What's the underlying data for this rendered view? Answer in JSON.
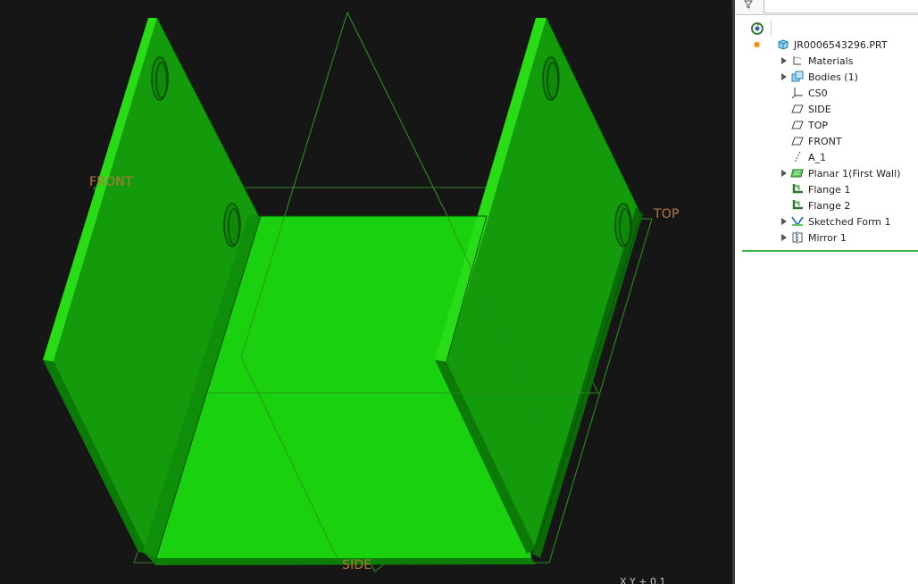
{
  "viewport": {
    "plane_labels": {
      "front": "FRONT",
      "top": "TOP",
      "side": "SIDE"
    },
    "coordinate_readout": "X Y + 0.1",
    "colors": {
      "background": "#161616",
      "part": "#22cc11",
      "datum": "#b8773f",
      "datum_lines": "#2e8a22"
    }
  },
  "model_tree": {
    "root": {
      "label": "JR0006543296.PRT",
      "icon": "part-icon"
    },
    "items": [
      {
        "label": "Materials",
        "icon": "materials-icon",
        "expandable": true
      },
      {
        "label": "Bodies (1)",
        "icon": "bodies-icon",
        "expandable": true
      },
      {
        "label": "CS0",
        "icon": "coordinate-system-icon",
        "expandable": false
      },
      {
        "label": "SIDE",
        "icon": "datum-plane-icon",
        "expandable": false
      },
      {
        "label": "TOP",
        "icon": "datum-plane-icon",
        "expandable": false
      },
      {
        "label": "FRONT",
        "icon": "datum-plane-icon",
        "expandable": false
      },
      {
        "label": "A_1",
        "icon": "datum-axis-icon",
        "expandable": false
      },
      {
        "label": "Planar 1(First Wall)",
        "icon": "planar-wall-icon",
        "expandable": true
      },
      {
        "label": "Flange 1",
        "icon": "flange-icon",
        "expandable": false
      },
      {
        "label": "Flange 2",
        "icon": "flange-icon",
        "expandable": false
      },
      {
        "label": "Sketched Form 1",
        "icon": "sketched-form-icon",
        "expandable": true
      },
      {
        "label": "Mirror 1",
        "icon": "mirror-icon",
        "expandable": true
      }
    ]
  }
}
